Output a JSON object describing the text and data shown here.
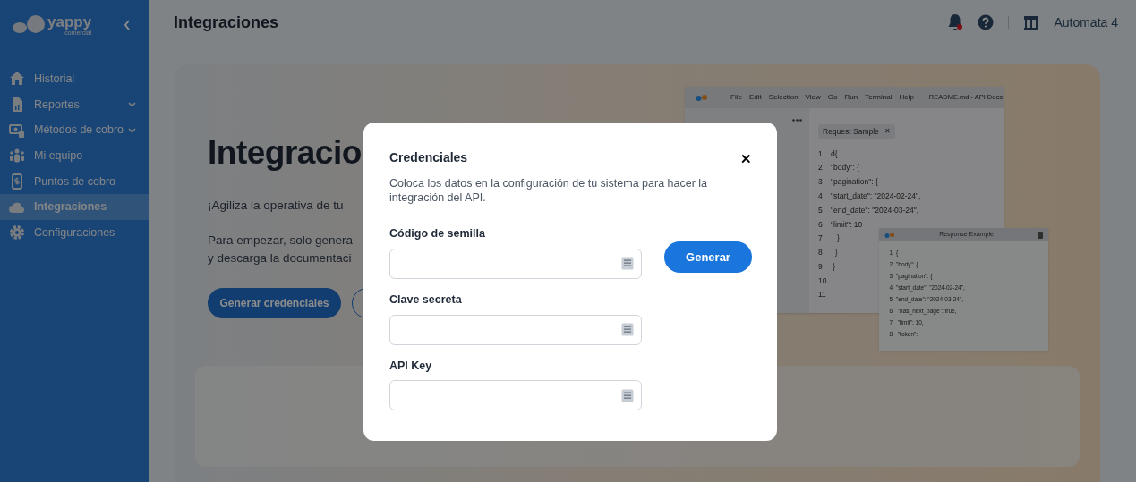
{
  "sidebar": {
    "logo": {
      "name": "yappy",
      "sub": "comercial"
    },
    "items": [
      {
        "label": "Historial",
        "selected": false,
        "submenu": false
      },
      {
        "label": "Reportes",
        "selected": false,
        "submenu": true
      },
      {
        "label": "Métodos de cobro",
        "selected": false,
        "submenu": true
      },
      {
        "label": "Mi equipo",
        "selected": false,
        "submenu": false
      },
      {
        "label": "Puntos de cobro",
        "selected": false,
        "submenu": false
      },
      {
        "label": "Integraciones",
        "selected": true,
        "submenu": false
      },
      {
        "label": "Configuraciones",
        "selected": false,
        "submenu": false
      }
    ]
  },
  "header": {
    "title": "Integraciones",
    "notification_dot": true,
    "account": "Automata 4"
  },
  "hero": {
    "title": "Integracio",
    "lines": [
      "¡Agiliza la operativa de tu",
      "Para empezar, solo genera",
      "y descarga la documentaci"
    ],
    "primary_button": "Generar credenciales"
  },
  "editor": {
    "menu": [
      "File",
      "Edit",
      "Selection",
      "View",
      "Go",
      "Run",
      "Terminal",
      "Help"
    ],
    "file_title": "README.md - API Docs",
    "tab": "Request Sample",
    "tab_close": "✕",
    "lines": [
      {
        "n": "1",
        "code": "d{"
      },
      {
        "n": "2",
        "code": "\"body\": {"
      },
      {
        "n": "3",
        "code": "\"pagination\": {"
      },
      {
        "n": "4",
        "code": "\"start_date\": \"2024-02-24\","
      },
      {
        "n": "5",
        "code": "\"end_date\": \"2024-03-24\","
      },
      {
        "n": "6",
        "code": "\"limit\": 10"
      },
      {
        "n": "7",
        "code": "   }"
      },
      {
        "n": "8",
        "code": "  }"
      },
      {
        "n": "9",
        "code": " }"
      },
      {
        "n": "10"
      },
      {
        "n": "11"
      }
    ]
  },
  "response": {
    "title": "Response Example",
    "lines": [
      {
        "n": "1",
        "code": "{"
      },
      {
        "n": "2",
        "code": "\"body\": {"
      },
      {
        "n": "3",
        "code": "\"pagination\": {"
      },
      {
        "n": "4",
        "code": "\"start_date\": \"2024-02-24\","
      },
      {
        "n": "5",
        "code": "\"end_date\": \"2024-03-24\","
      },
      {
        "n": "6",
        "code": " \"has_next_page\": true,"
      },
      {
        "n": "7",
        "code": " \"limit\": 10,"
      },
      {
        "n": "8",
        "code": " \"token\":"
      }
    ]
  },
  "modal": {
    "title": "Credenciales",
    "close": "✕",
    "description": "Coloca los datos en la configuración de tu sistema para hacer la integración del API.",
    "fields": [
      {
        "label": "Código de semilla"
      },
      {
        "label": "Clave secreta"
      },
      {
        "label": "API Key"
      }
    ],
    "generate_button": "Generar"
  }
}
